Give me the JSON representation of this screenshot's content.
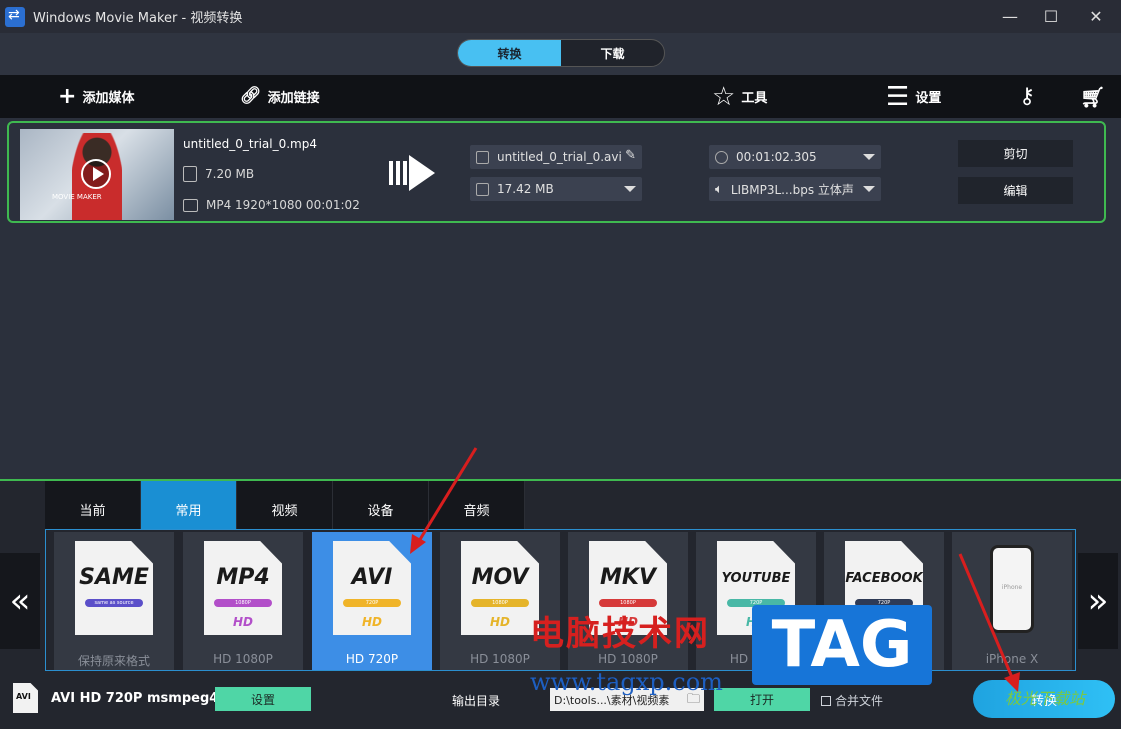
{
  "window": {
    "title": "Windows Movie Maker - 视频转换"
  },
  "mode_switch": {
    "convert": "转换",
    "download": "下载"
  },
  "toolbar": {
    "add_media": "添加媒体",
    "add_link": "添加链接",
    "tools": "工具",
    "settings": "设置"
  },
  "file": {
    "thumb_label": "MOVIE MAKER",
    "name": "untitled_0_trial_0.mp4",
    "size": "7.20 MB",
    "info": "MP4 1920*1080 00:01:02",
    "output_name": "untitled_0_trial_0.avi",
    "output_size": "17.42 MB",
    "duration": "00:01:02.305",
    "audio": "LIBMP3L...bps 立体声",
    "cut_label": "剪切",
    "edit_label": "编辑"
  },
  "categories": [
    "当前",
    "常用",
    "视频",
    "设备",
    "音频"
  ],
  "formats": [
    {
      "name": "SAME",
      "sub": "same as source",
      "hd": "",
      "label": "保持原来格式",
      "pill": "#5b4fc9",
      "hd_color": "#5b4fc9"
    },
    {
      "name": "MP4",
      "sub": "1080P",
      "hd": "HD",
      "label": "HD 1080P",
      "pill": "#b24fc9",
      "hd_color": "#b24fc9"
    },
    {
      "name": "AVI",
      "sub": "720P",
      "hd": "HD",
      "label": "HD 720P",
      "pill": "#f0b429",
      "hd_color": "#f0b429"
    },
    {
      "name": "MOV",
      "sub": "1080P",
      "hd": "HD",
      "label": "HD 1080P",
      "pill": "#e5b42a",
      "hd_color": "#e5b42a"
    },
    {
      "name": "MKV",
      "sub": "1080P",
      "hd": "HD",
      "label": "HD 1080P",
      "pill": "#d63a3a",
      "hd_color": "#d63a3a"
    },
    {
      "name": "YOUTUBE",
      "sub": "720P",
      "hd": "HD",
      "label": "HD 720P",
      "pill": "#49b8a6",
      "hd_color": "#49b8a6"
    },
    {
      "name": "FACEBOOK",
      "sub": "720P",
      "hd": "HD",
      "label": "",
      "pill": "#2e3a55",
      "hd_color": "#3b5bdb"
    },
    {
      "name": "",
      "sub": "iPhone",
      "hd": "",
      "label": "iPhone X",
      "pill": "",
      "hd_color": ""
    }
  ],
  "status": {
    "icon_text": "AVI",
    "format_title": "AVI HD 720P msmpeg4",
    "settings_label": "设置",
    "output_dir_label": "输出目录",
    "output_path": "D:\\tools...\\素材\\视频素",
    "open_label": "打开",
    "merge_label": "合并文件",
    "convert_label": "转换"
  },
  "watermark": {
    "text": "电脑技术网",
    "url": "www.tagxp.com",
    "tag": "TAG",
    "logo": "极光下载站"
  },
  "colors": {
    "accent": "#48c0f2",
    "selected_tile": "#3d8ee6",
    "card_border": "#3fb950",
    "button_green": "#4fd6a6"
  }
}
